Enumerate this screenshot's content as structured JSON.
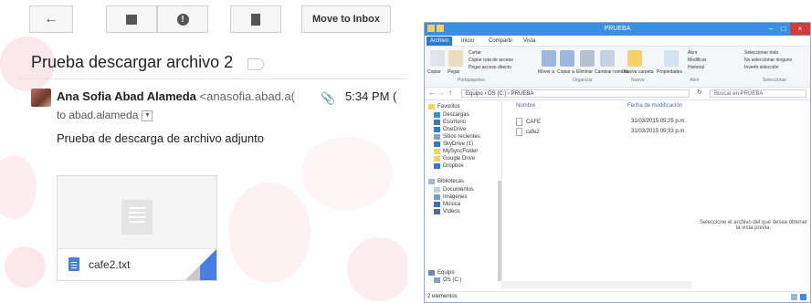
{
  "gmail": {
    "toolbar": {
      "back_icon": "arrow-back-icon",
      "archive_icon": "archive-icon",
      "spam_icon": "report-spam-icon",
      "delete_icon": "trash-icon",
      "move_to_inbox": "Move to Inbox"
    },
    "subject": "Prueba descargar archivo 2",
    "sender_name": "Ana Sofia Abad Alameda",
    "sender_email": "<anasofia.abad.a(",
    "time": "5:34 PM (",
    "to_line": "to abad.alameda",
    "body": "Prueba de descarga de archivo adjunto",
    "attachment": {
      "name": "cafe2.txt",
      "accent_color": "#4a7fe0"
    }
  },
  "explorer": {
    "title": "PRUEBA",
    "tabs": [
      "Archivo",
      "Inicio",
      "Compartir",
      "Vista"
    ],
    "ribbon": {
      "copiar": "Copiar",
      "pegar": "Pegar",
      "cortar": "Cortar",
      "copiar_ruta": "Copiar ruta de acceso",
      "pegar_acceso": "Pegar acceso directo",
      "portapapeles": "Portapapeles",
      "mover_a": "Mover a",
      "copiar_a": "Copiar a",
      "eliminar": "Eliminar",
      "cambiar_nombre": "Cambiar nombre",
      "organizar": "Organizar",
      "nueva_carpeta": "Nueva carpeta",
      "nuevo": "Nuevo",
      "propiedades": "Propiedades",
      "abrir": "Abrir",
      "modificar": "Modificar",
      "historial": "Historial",
      "abrir_group": "Abrir",
      "seleccionar_todo": "Seleccionar todo",
      "no_seleccionar": "No seleccionar ninguno",
      "invertir": "Invertir selección",
      "seleccionar": "Seleccionar"
    },
    "address": "Equipo  ›  OS (C:)  ›  PRUEBA",
    "search_placeholder": "Buscar en PRUEBA",
    "nav": [
      "Favoritos",
      "Descargas",
      "Escritorio",
      "OneDrive",
      "Sitios recientes",
      "SkyDrive (1)",
      "MySyncFolder",
      "Google Drive",
      "Dropbox",
      "Bibliotecas",
      "Documentos",
      "Imágenes",
      "Música",
      "Vídeos",
      "Equipo",
      "OS (C:)"
    ],
    "columns": {
      "name": "Nombre",
      "date": "Fecha de modificación"
    },
    "files": [
      {
        "name": "CAFE",
        "date": "31/03/2015 05:25 p.m."
      },
      {
        "name": "cafe2",
        "date": "31/03/2015 05:33 p.m."
      }
    ],
    "preview_text": "Seleccione el archivo del que desea obtener la vista previa.",
    "status": "2 elementos",
    "accent_color": "#3b8fe0"
  }
}
